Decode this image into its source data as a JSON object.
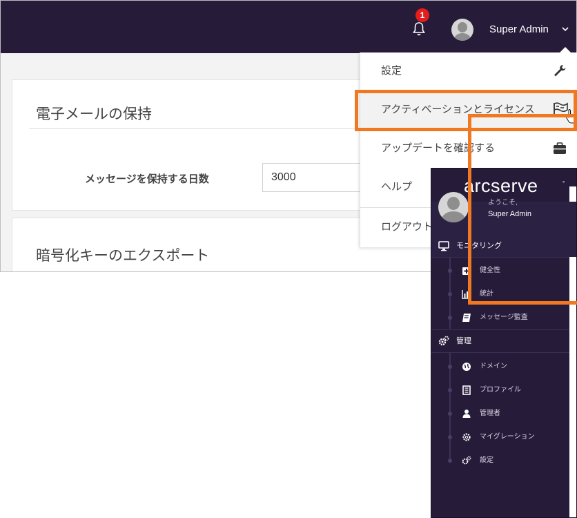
{
  "header": {
    "notification_count": "1",
    "user_name": "Super Admin"
  },
  "retention_card": {
    "title": "電子メールの保持",
    "days_label": "メッセージを保持する日数",
    "days_value": "3000"
  },
  "export_card": {
    "title": "暗号化キーのエクスポート"
  },
  "user_menu": {
    "items": [
      {
        "label": "設定",
        "icon": "wrench-icon"
      },
      {
        "label": "アクティベーションとライセンス",
        "icon": "flag-icon"
      },
      {
        "label": "アップデートを確認する",
        "icon": "briefcase-icon"
      },
      {
        "label": "ヘルプ",
        "icon": "help-icon"
      },
      {
        "label": "ログアウト",
        "icon": "logout-icon"
      }
    ]
  },
  "sidebar": {
    "logo": "arcserve",
    "welcome": "ようこそ,",
    "user_name": "Super Admin",
    "sections": [
      {
        "label": "モニタリング",
        "icon": "monitor-icon",
        "items": [
          {
            "label": "健全性",
            "icon": "health-icon"
          },
          {
            "label": "統計",
            "icon": "bar-chart-icon"
          },
          {
            "label": "メッセージ監査",
            "icon": "book-icon"
          }
        ]
      },
      {
        "label": "管理",
        "icon": "gears-icon",
        "items": [
          {
            "label": "ドメイン",
            "icon": "globe-icon"
          },
          {
            "label": "プロファイル",
            "icon": "profile-icon"
          },
          {
            "label": "管理者",
            "icon": "user-icon"
          },
          {
            "label": "マイグレーション",
            "icon": "migration-icon"
          },
          {
            "label": "設定",
            "icon": "gears-icon"
          }
        ]
      }
    ]
  },
  "colors": {
    "topbar": "#261c3a",
    "highlight": "#f07820",
    "badge": "#e41d1d"
  }
}
